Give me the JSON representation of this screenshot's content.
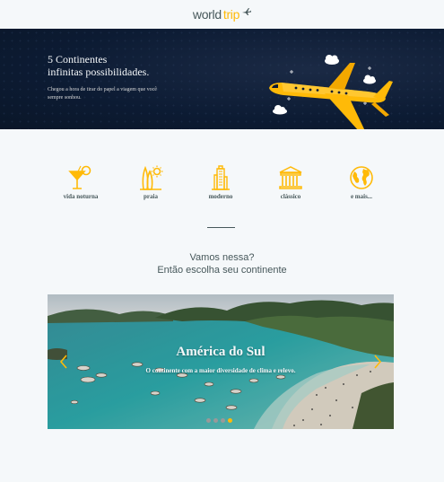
{
  "header": {
    "logo_part1": "world",
    "logo_part2": "trip"
  },
  "banner": {
    "title_line1": "5 Continentes",
    "title_line2": "infinitas possibilidades.",
    "text": "Chegou a hora de tirar do papel a viagem que você sempre sonhou."
  },
  "travel_types": [
    {
      "label": "vida noturna",
      "icon": "cocktail-icon"
    },
    {
      "label": "praia",
      "icon": "surfboard-icon"
    },
    {
      "label": "moderno",
      "icon": "building-icon"
    },
    {
      "label": "clássico",
      "icon": "museum-icon"
    },
    {
      "label": "e mais...",
      "icon": "earth-icon"
    }
  ],
  "prompt": {
    "line1": "Vamos nessa?",
    "line2": "Então escolha seu continente"
  },
  "carousel": {
    "title": "América do Sul",
    "subtitle": "O continente com a maior diversidade de clima e relevo.",
    "slide_count": 4,
    "active_index": 3
  },
  "colors": {
    "accent": "#ffba08",
    "text_dark": "#47585b",
    "banner_bg": "#0c1b33",
    "page_bg": "#f5f8fa"
  }
}
